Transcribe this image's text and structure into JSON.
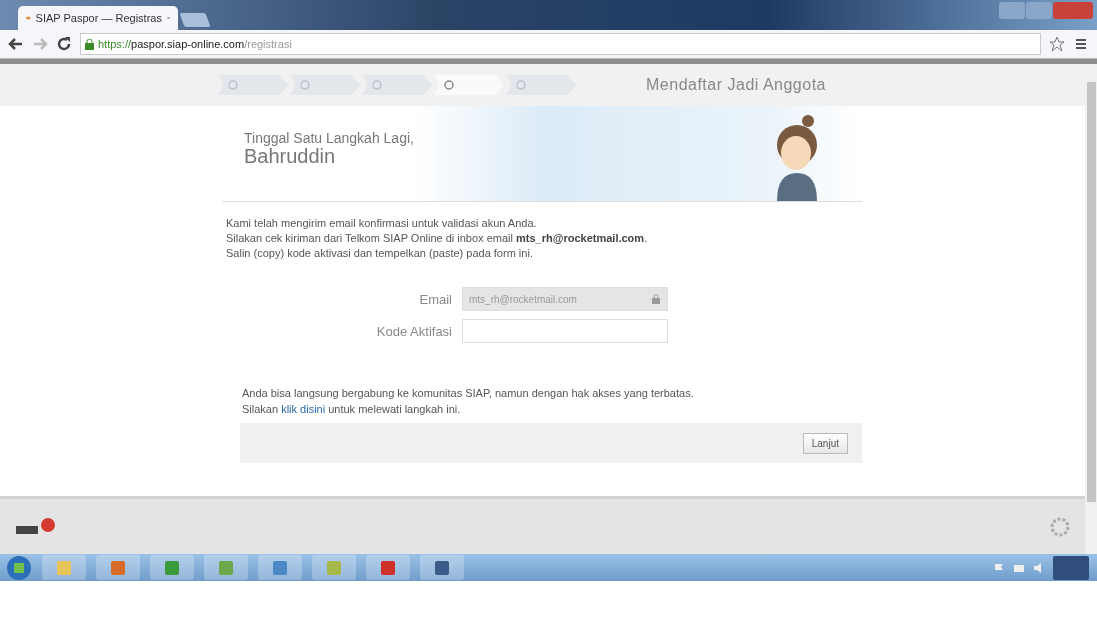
{
  "browser": {
    "tab_title": "SIAP Paspor — Registras",
    "url_host": "https://paspor.siap-online.com",
    "url_path": "/registrasi"
  },
  "steps": [
    {
      "selected": false
    },
    {
      "selected": false
    },
    {
      "selected": false
    },
    {
      "selected": true
    },
    {
      "selected": false
    }
  ],
  "page_title": "Mendaftar Jadi Anggota",
  "banner": {
    "subtitle": "Tinggal Satu Langkah Lagi,",
    "name": "Bahruddin"
  },
  "intro": [
    "Kami telah mengirim email konfirmasi untuk validasi akun Anda.",
    "Silakan cek kiriman dari Telkom SIAP Online di inbox email **mts_rh@rocketmail.com**.",
    "Salin (copy) kode aktivasi dan tempelkan (paste) pada form ini."
  ],
  "form": [
    {
      "label": "Email",
      "value": "mts_rh@rocketmail.com",
      "locked": true
    },
    {
      "label": "Kode Aktifasi",
      "locked": false
    }
  ],
  "skip_note": {
    "line1": "Anda bisa langsung bergabung ke komunitas SIAP, namun dengan hak akses yang terbatas.",
    "before": "Silakan ",
    "link": "klik disini",
    "after": " untuk melewati langkah ini."
  },
  "button": "Lanjut"
}
